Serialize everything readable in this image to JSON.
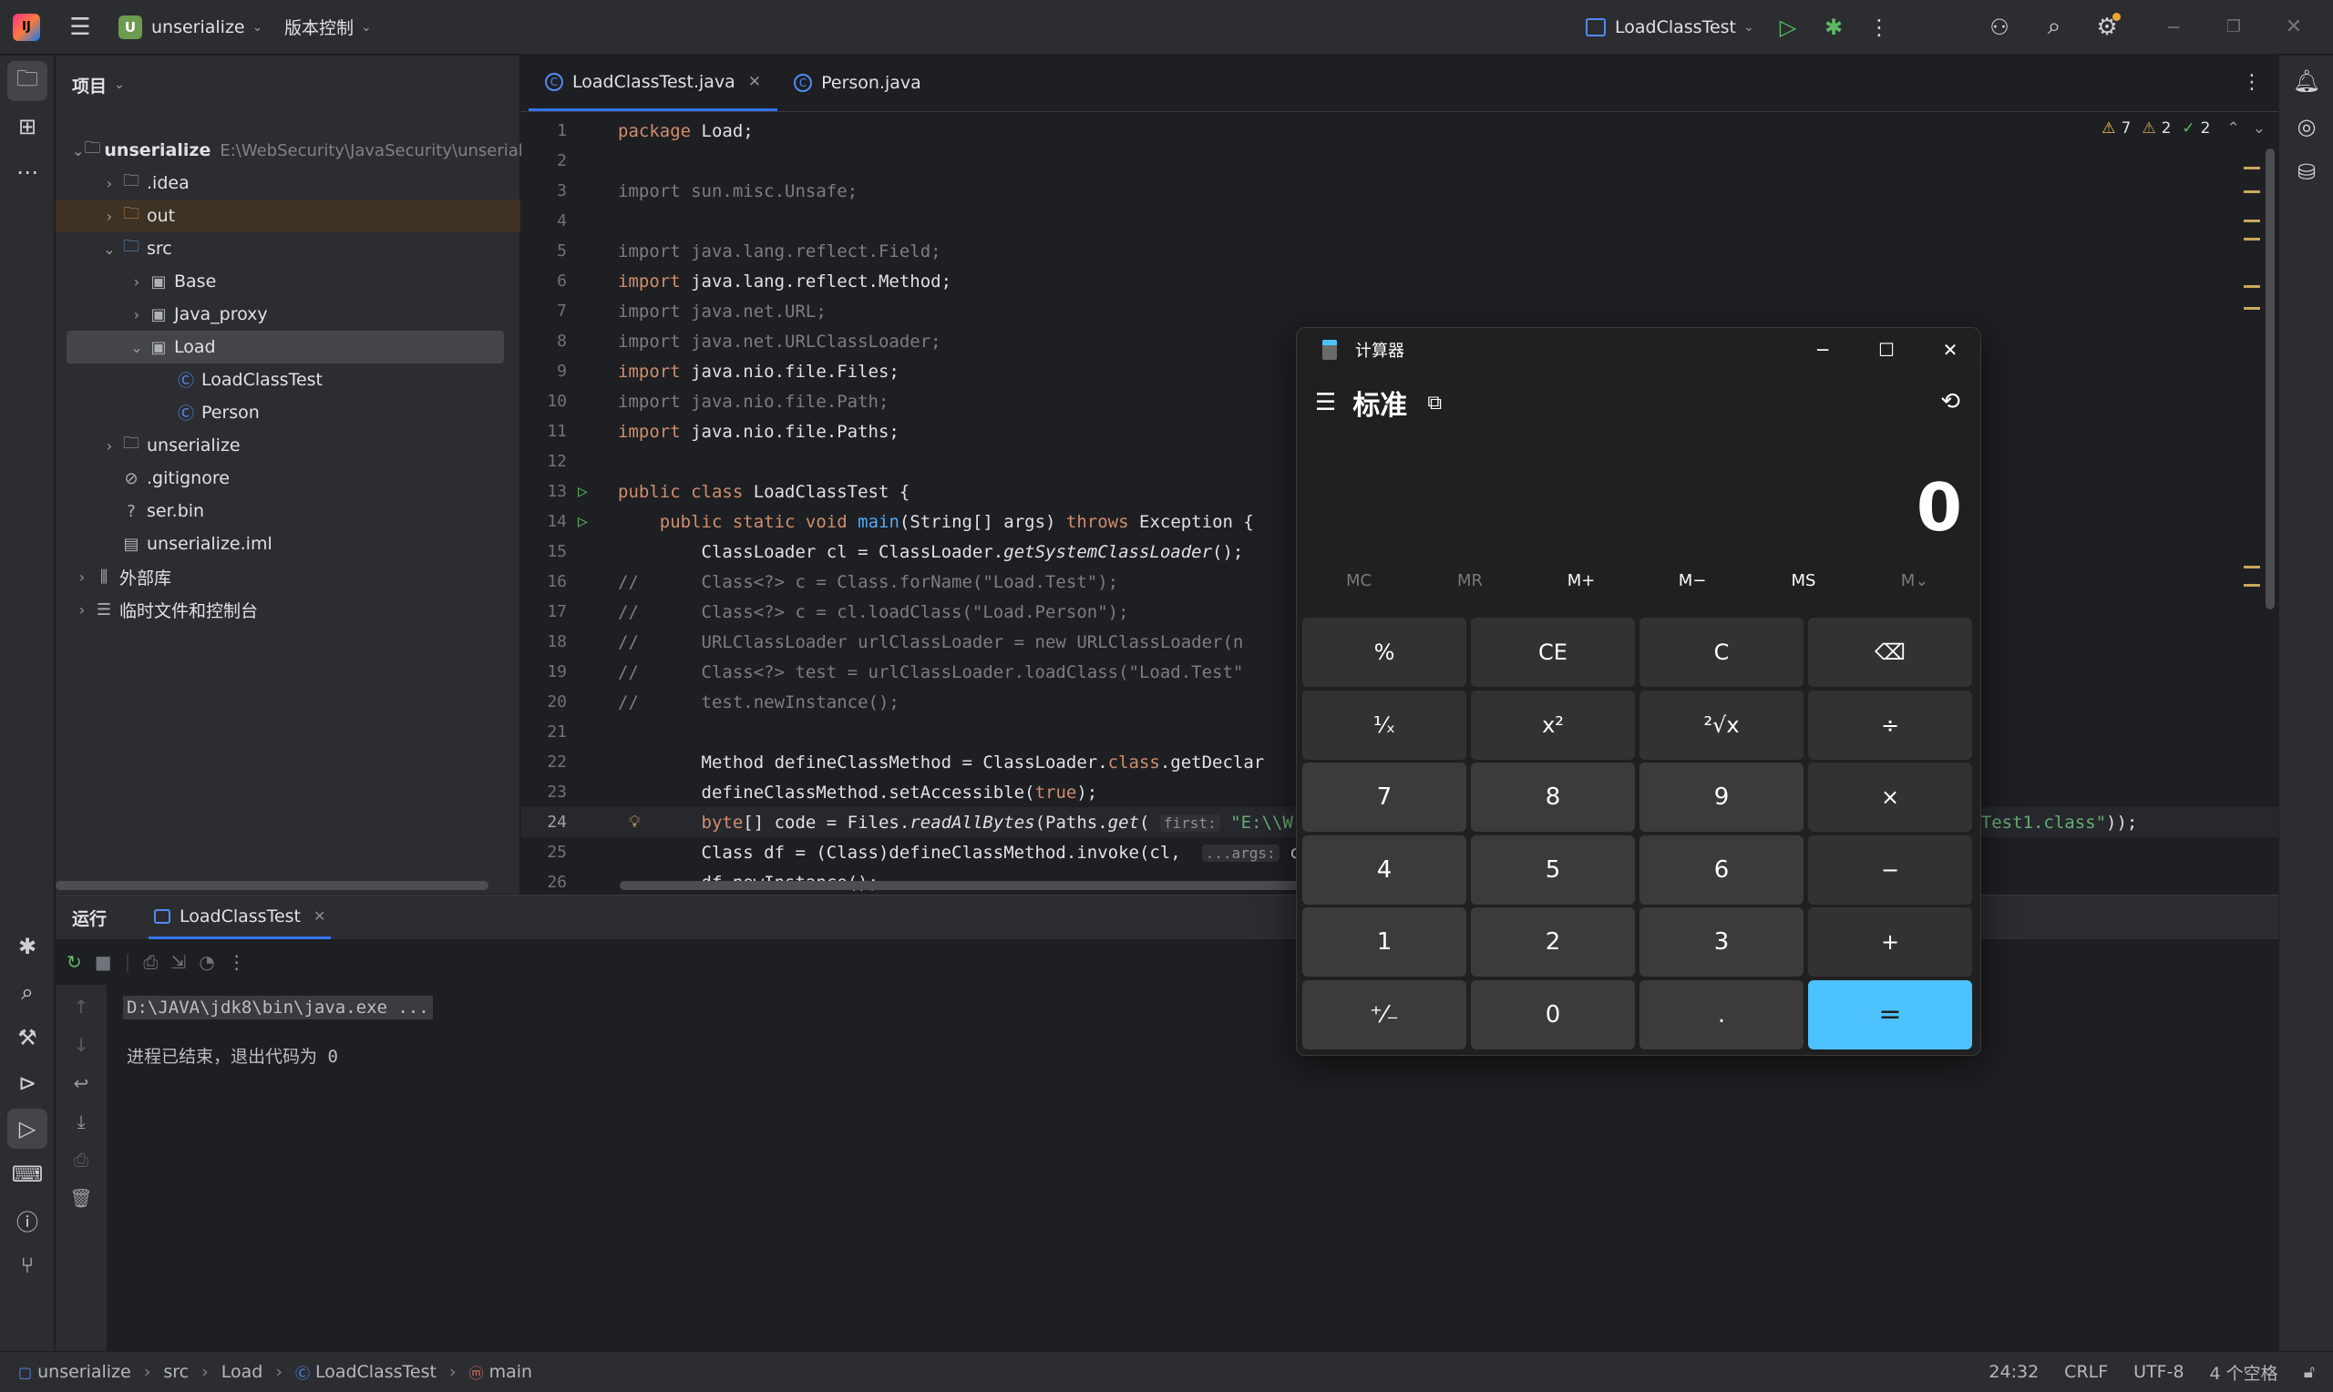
{
  "titlebar": {
    "project_badge": "U",
    "project_name": "unserialize",
    "vcs": "版本控制",
    "run_config": "LoadClassTest"
  },
  "project_panel": {
    "title": "项目",
    "tree": [
      {
        "label": "unserialize",
        "path": "E:\\WebSecurity\\JavaSecurity\\unserializ",
        "depth": 0,
        "icon": "folder-module-icon",
        "expanded": true,
        "bold": true
      },
      {
        "label": ".idea",
        "depth": 1,
        "icon": "folder-icon",
        "expanded": false
      },
      {
        "label": "out",
        "depth": 1,
        "icon": "folder-excluded-icon",
        "expanded": false,
        "excluded": true
      },
      {
        "label": "src",
        "depth": 1,
        "icon": "folder-source-icon",
        "expanded": true
      },
      {
        "label": "Base",
        "depth": 2,
        "icon": "package-icon",
        "expanded": false
      },
      {
        "label": "Java_proxy",
        "depth": 2,
        "icon": "package-icon",
        "expanded": false
      },
      {
        "label": "Load",
        "depth": 2,
        "icon": "package-icon",
        "expanded": true,
        "selected": true
      },
      {
        "label": "LoadClassTest",
        "depth": 3,
        "icon": "class-icon"
      },
      {
        "label": "Person",
        "depth": 3,
        "icon": "class-icon"
      },
      {
        "label": "unserialize",
        "depth": 1,
        "icon": "folder-icon",
        "expanded": false
      },
      {
        "label": ".gitignore",
        "depth": 1,
        "icon": "ignore-file-icon"
      },
      {
        "label": "ser.bin",
        "depth": 1,
        "icon": "unknown-file-icon"
      },
      {
        "label": "unserialize.iml",
        "depth": 1,
        "icon": "iml-file-icon"
      },
      {
        "label": "外部库",
        "depth": 0,
        "icon": "library-icon",
        "expanded": false
      },
      {
        "label": "临时文件和控制台",
        "depth": 0,
        "icon": "scratch-icon",
        "expanded": false
      }
    ]
  },
  "editor": {
    "tabs": [
      {
        "label": "LoadClassTest.java",
        "active": true
      },
      {
        "label": "Person.java",
        "active": false
      }
    ],
    "inspections": {
      "warnings": "7",
      "weak_warnings": "2",
      "ok": "2"
    },
    "code_lines": [
      {
        "n": "1",
        "html": "<span class='kw'>package</span> Load;"
      },
      {
        "n": "2",
        "html": ""
      },
      {
        "n": "3",
        "html": "<span class='cm'>import sun.misc.Unsafe;</span>"
      },
      {
        "n": "4",
        "html": ""
      },
      {
        "n": "5",
        "html": "<span class='cm'>import java.lang.reflect.Field;</span>"
      },
      {
        "n": "6",
        "html": "<span class='kw'>import</span> java.lang.reflect.Method;"
      },
      {
        "n": "7",
        "html": "<span class='cm'>import java.net.URL;</span>"
      },
      {
        "n": "8",
        "html": "<span class='cm'>import java.net.URLClassLoader;</span>"
      },
      {
        "n": "9",
        "html": "<span class='kw'>import</span> java.nio.file.Files;"
      },
      {
        "n": "10",
        "html": "<span class='cm'>import java.nio.file.Path;</span>"
      },
      {
        "n": "11",
        "html": "<span class='kw'>import</span> java.nio.file.Paths;"
      },
      {
        "n": "12",
        "html": ""
      },
      {
        "n": "13",
        "html": "<span class='kw'>public class</span> LoadClassTest {",
        "run": true
      },
      {
        "n": "14",
        "html": "    <span class='kw'>public static void</span> <span class='fn'>main</span>(String[] args) <span class='kw'>throws</span> Exception {",
        "run": true
      },
      {
        "n": "15",
        "html": "        ClassLoader cl = ClassLoader.<span class='it'>getSystemClassLoader</span>();"
      },
      {
        "n": "16",
        "html": "<span class='cm'>//      Class&lt;?&gt; c = Class.forName(\"Load.Test\");</span>"
      },
      {
        "n": "17",
        "html": "<span class='cm'>//      Class&lt;?&gt; c = cl.loadClass(\"Load.Person\");</span>"
      },
      {
        "n": "18",
        "html": "<span class='cm'>//      URLClassLoader urlClassLoader = new URLClassLoader(n</span>"
      },
      {
        "n": "19",
        "html": "<span class='cm'>//      Class&lt;?&gt; test = urlClassLoader.loadClass(\"Load.Test\"</span>"
      },
      {
        "n": "20",
        "html": "<span class='cm'>//      test.newInstance();</span>"
      },
      {
        "n": "21",
        "html": ""
      },
      {
        "n": "22",
        "html": "        Method defineClassMethod = ClassLoader.<span class='kw'>class</span>.getDeclar                                                      s);"
      },
      {
        "n": "23",
        "html": "        defineClassMethod.setAccessible(<span class='kw'>true</span>);"
      },
      {
        "n": "24",
        "html": "        <span class='kw'>byte</span>[] code = Files.<span class='it'>readAllBytes</span>(Paths.<span class='it'>get</span>( <span class='hint'>first:</span> <span class='st'>\"E:\\\\W</span>                                                      <span class='st'>lize\\\\Load\\\\Test1.class\"</span>));",
        "current": true,
        "bulb": true
      },
      {
        "n": "25",
        "html": "        Class df = (Class)defineClassMethod.invoke(cl,  <span class='hint'>...args:</span> c"
      },
      {
        "n": "26",
        "html": "        df.newInstance();"
      }
    ]
  },
  "run_panel": {
    "title": "运行",
    "tab": "LoadClassTest",
    "console_lines": [
      "D:\\JAVA\\jdk8\\bin\\java.exe ...",
      "",
      "进程已结束，退出代码为 0"
    ]
  },
  "status_bar": {
    "breadcrumbs": [
      "unserialize",
      "src",
      "Load",
      "LoadClassTest",
      "main"
    ],
    "position": "24:32",
    "line_ending": "CRLF",
    "encoding": "UTF-8",
    "indent": "4 个空格"
  },
  "calculator": {
    "title": "计算器",
    "mode": "标准",
    "display": "0",
    "memory": [
      "MC",
      "MR",
      "M+",
      "M−",
      "MS",
      "M⌄"
    ],
    "keys": [
      [
        "%",
        "CE",
        "C",
        "⌫"
      ],
      [
        "¹⁄ₓ",
        "x²",
        "²√x",
        "÷"
      ],
      [
        "7",
        "8",
        "9",
        "×"
      ],
      [
        "4",
        "5",
        "6",
        "−"
      ],
      [
        "1",
        "2",
        "3",
        "+"
      ],
      [
        "⁺⁄₋",
        "0",
        ".",
        "="
      ]
    ]
  }
}
